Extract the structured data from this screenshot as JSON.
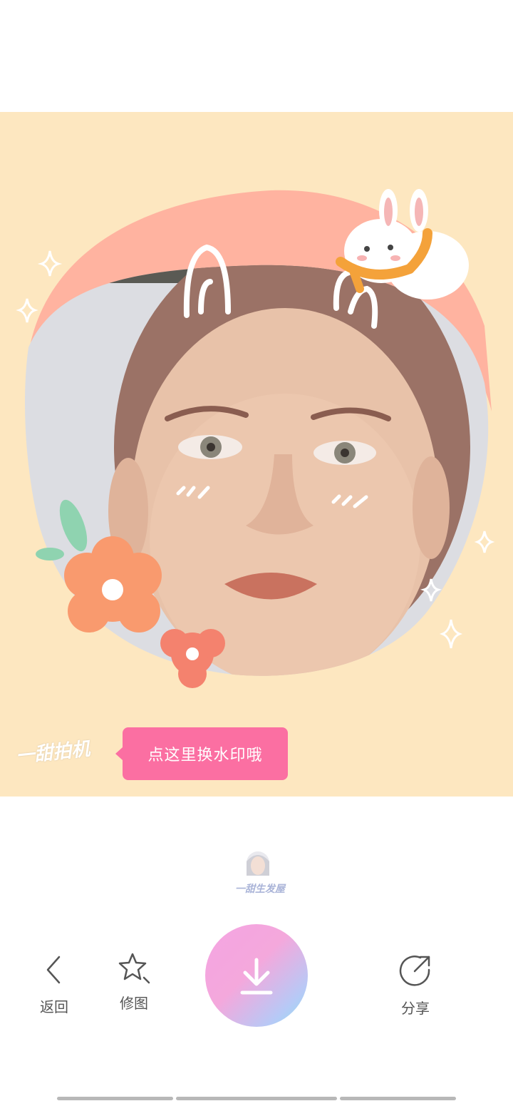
{
  "canvas": {
    "background": "#fde7c0",
    "tooltip_text": "点这里换水印哦",
    "watermark_text": "一甜拍机"
  },
  "thumbnail": {
    "caption": "一甜生发屋"
  },
  "toolbar": {
    "back_label": "返回",
    "edit_label": "修图",
    "share_label": "分享"
  },
  "colors": {
    "accent": "#fb6fa2",
    "arc": "#ffb3a0"
  },
  "icons": {
    "back": "chevron-left-icon",
    "edit": "star-edit-icon",
    "save": "download-icon",
    "share": "share-icon"
  }
}
